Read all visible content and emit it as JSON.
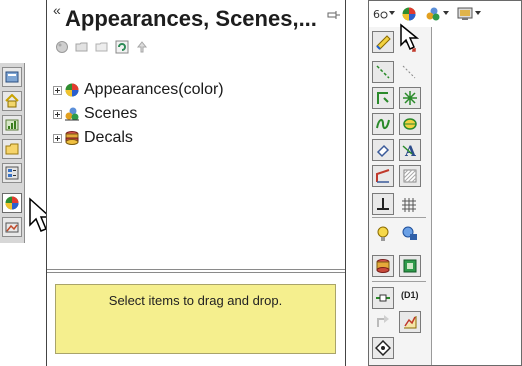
{
  "left_panel": {
    "title": "Appearances, Scenes,...",
    "collapse_glyph": "«",
    "toolbar_icons": [
      "appearance-tree-icon",
      "open-folder-icon",
      "folder-icon",
      "refresh-icon",
      "up-arrow-icon"
    ],
    "vertical_tabs": [
      "feature-manager-icon",
      "property-manager-icon",
      "configuration-manager-icon",
      "design-library-icon",
      "file-explorer-icon",
      "view-palette-icon",
      "appearances-icon",
      "custom-properties-icon"
    ],
    "tree": [
      {
        "label": "Appearances(color)",
        "icon": "color-ball-icon"
      },
      {
        "label": "Scenes",
        "icon": "scene-icon"
      },
      {
        "label": "Decals",
        "icon": "decal-stack-icon"
      }
    ],
    "drop_hint": "Select items to drag and drop."
  },
  "right_panel": {
    "toolbar_icons": [
      "dimension-icon",
      "dropdown-arrow-icon",
      "appearance-ball-icon",
      "scene-icon",
      "dropdown-arrow-icon",
      "display-icon",
      "dropdown-arrow-icon"
    ],
    "flyout_d1_label": "(D1)",
    "flyout_icons": [
      "smart-dimension-icon",
      "move-entities-icon",
      "centerline-icon",
      "construction-line-icon",
      "convert-entities-icon",
      "plane-icon",
      "spline-icon",
      "fill-icon",
      "weld-bead-icon",
      "note-icon",
      "edge-icon",
      "hatch-icon",
      "base-datum-icon",
      "grid-icon",
      "bulb-icon",
      "camera-icon",
      "decal-icon",
      "layout-icon",
      "dim-input-icon",
      "d1-label",
      "smart-mate-icon",
      "sketch-chart-icon",
      "view-orient-icon"
    ]
  }
}
